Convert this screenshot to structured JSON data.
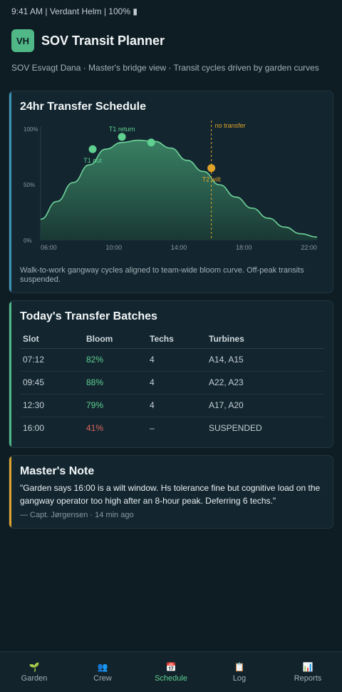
{
  "status_bar": {
    "text": "9:41 AM | Verdant Helm | 100% ▮"
  },
  "header": {
    "avatar": "VH",
    "title": "SOV Transit Planner"
  },
  "subtitle": "SOV Esvagt Dana · Master's bridge view · Transit cycles driven by garden curves",
  "schedule_card": {
    "title": "24hr Transfer Schedule",
    "caption": "Walk-to-work gangway cycles aligned to team-wide bloom curve. Off-peak transits suspended.",
    "cutoff_label": "no transfer"
  },
  "chart_data": {
    "type": "area",
    "title": "",
    "x_ticks": [
      "06:00",
      "10:00",
      "14:00",
      "18:00",
      "22:00"
    ],
    "y_ticks": [
      "0%",
      "50%",
      "100%"
    ],
    "xlim": [
      5.5,
      22.5
    ],
    "ylim": [
      0,
      100
    ],
    "grid": false,
    "series": [
      {
        "x": [
          5.5,
          6.5,
          7.5,
          8.5,
          9.5,
          10.5,
          11.5,
          12.5,
          13.5,
          14.5,
          15.5,
          16.5,
          17.5,
          18.5,
          19.5,
          20.5,
          21.5,
          22.5
        ],
        "y": [
          19,
          35,
          52,
          68,
          82,
          88,
          90,
          89,
          83,
          72,
          62,
          50,
          39,
          29,
          20,
          12,
          6,
          3
        ]
      }
    ],
    "markers": [
      {
        "x": 8.7,
        "y": 82,
        "label": "T1 out",
        "color": "#5fd08f"
      },
      {
        "x": 10.5,
        "y": 93,
        "label": "T1 return",
        "color": "#5fd08f"
      },
      {
        "x": 12.3,
        "y": 88,
        "label": "",
        "color": "#5fd08f"
      },
      {
        "x": 16.0,
        "y": 65,
        "label": "T2 wilt",
        "color": "#e0a32a"
      }
    ],
    "cutoff_x": 16.0
  },
  "batches_card": {
    "title": "Today's Transfer Batches",
    "headers": [
      "Slot",
      "Bloom",
      "Techs",
      "Turbines"
    ],
    "rows": [
      {
        "slot": "07:12",
        "bloom": "82%",
        "techs": "4",
        "turbines": "A14, A15",
        "status": "good"
      },
      {
        "slot": "09:45",
        "bloom": "88%",
        "techs": "4",
        "turbines": "A22, A23",
        "status": "good"
      },
      {
        "slot": "12:30",
        "bloom": "79%",
        "techs": "4",
        "turbines": "A17, A20",
        "status": "good"
      },
      {
        "slot": "16:00",
        "bloom": "41%",
        "techs": "–",
        "turbines": "SUSPENDED",
        "status": "bad"
      }
    ]
  },
  "note_card": {
    "title": "Master's Note",
    "quote": "\"Garden says 16:00 is a wilt window. Hs tolerance fine but cognitive load on the gangway operator too high after an 8-hour peak. Deferring 6 techs.\"",
    "byline": "— Capt. Jørgensen · 14 min ago"
  },
  "nav": [
    {
      "icon": "🌱",
      "icon_name": "sprout-icon",
      "label": "Garden",
      "active": false
    },
    {
      "icon": "👥",
      "icon_name": "people-icon",
      "label": "Crew",
      "active": false
    },
    {
      "icon": "📅",
      "icon_name": "calendar-icon",
      "label": "Schedule",
      "active": true
    },
    {
      "icon": "📋",
      "icon_name": "clipboard-icon",
      "label": "Log",
      "active": false
    },
    {
      "icon": "📊",
      "icon_name": "bar-chart-icon",
      "label": "Reports",
      "active": false
    }
  ],
  "colors": {
    "accent_green": "#5fd08f",
    "warn_orange": "#e0a32a",
    "bad_red": "#e0665c",
    "background": "#0e1c24"
  }
}
